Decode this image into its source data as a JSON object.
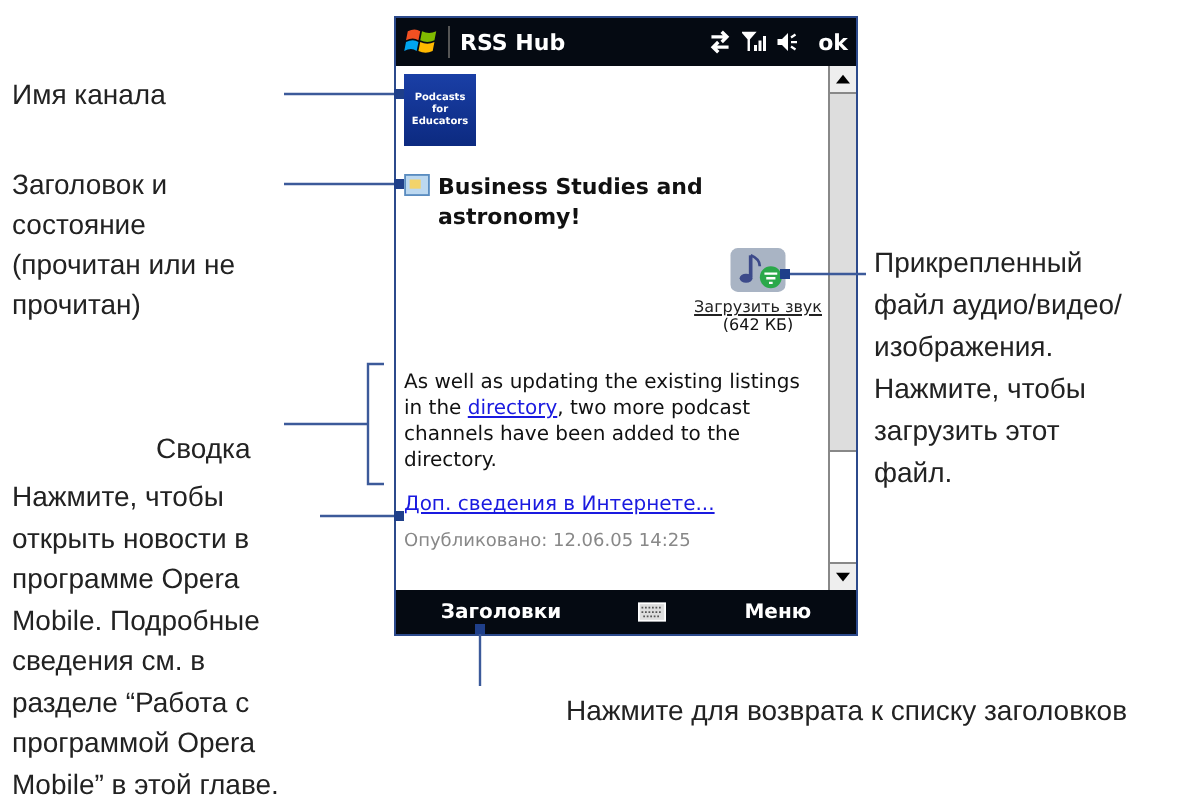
{
  "left_callouts": [
    {
      "text": "Имя канала"
    },
    {
      "text": "Заголовок и состояние (прочитан или не прочитан)"
    },
    {
      "text": "Сводка"
    },
    {
      "text": "Нажмите, чтобы открыть новости в программе Opera Mobile. Подробные сведения см. в разделе “Работа с программой Opera Mobile” в этой главе."
    }
  ],
  "right_callout": "Прикрепленный файл аудио/видео/ изображения. Нажмите, чтобы загрузить этот файл.",
  "bottom_callout": "Нажмите для возврата к списку заголовков",
  "phone": {
    "title": "RSS Hub",
    "ok": "ok",
    "channel_logo": "Podcasts for Educators",
    "headline": "Business Studies and astronomy!",
    "attachment": {
      "link": "Загрузить звук",
      "size": "(642 КБ)"
    },
    "summary": {
      "before": "As well as updating the existing listings in the ",
      "link": "directory",
      "after": ", two more podcast channels have been added to the directory."
    },
    "more_link": "Доп. сведения в Интернете...",
    "published": "Опубликовано: 12.06.05 14:25",
    "softkeys": {
      "left": "Заголовки",
      "right": "Меню"
    }
  }
}
